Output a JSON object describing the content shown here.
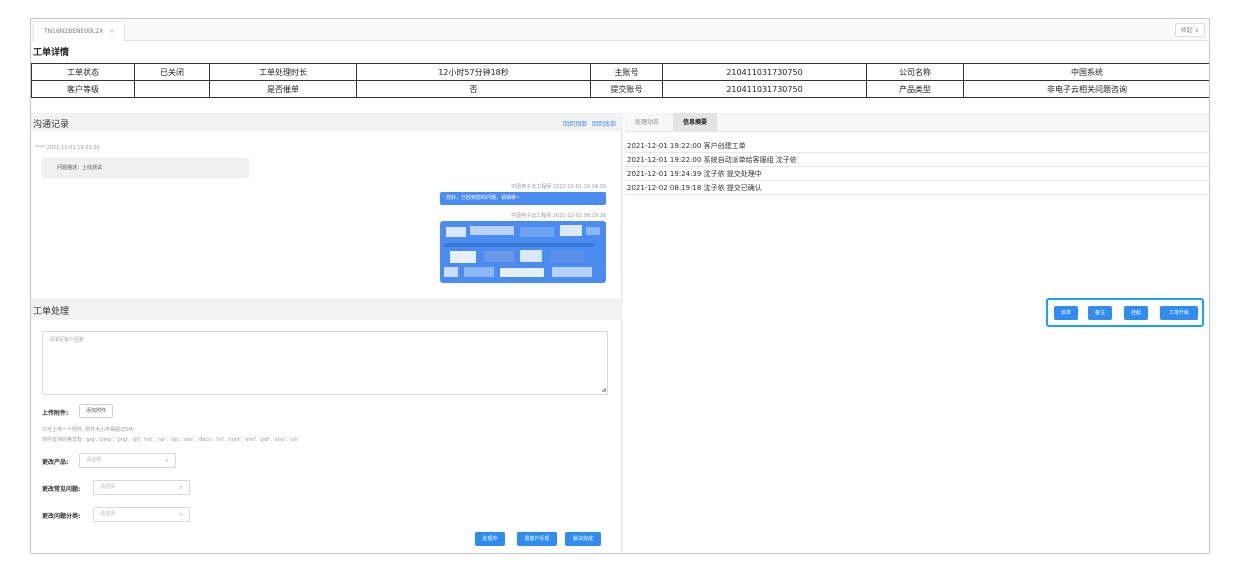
{
  "tab": {
    "title": "TN16N2BENE00L2X",
    "close": "×"
  },
  "header": {
    "collapse": "收起 ∨"
  },
  "ticket_detail": {
    "title": "工单详情"
  },
  "info_table": {
    "row1": [
      "工单状态",
      "已关闭",
      "工单处理时长",
      "12小时57分钟18秒",
      "主账号",
      "210411031730750",
      "公司名称",
      "中国系统"
    ],
    "row2": [
      "客户等级",
      "",
      "是否催单",
      "否",
      "提交账号",
      "210411031730750",
      "产品类型",
      "非电子云相关问题咨询"
    ]
  },
  "chat": {
    "title": "沟通记录",
    "link_top": "回到顶部",
    "link_bottom": "回到底部",
    "customer_meta": "****  2021-12-01 19:22:00",
    "customer_msg": "问题描述：上线测试",
    "agent_meta1": "中国电子云工程师  2021-12-01 19:24:39",
    "agent_msg1": "您好，已收到您的问题，请稍等~",
    "agent_meta2": "中国电子云工程师  2021-12-02 08:19:18"
  },
  "right_panel": {
    "tabs": [
      "处理动态",
      "信息摘要"
    ],
    "log": [
      "2021-12-01 19:22:00 客户创建工单",
      "2021-12-01 19:22:00 系统自动派单给客服组 沈子依",
      "2021-12-01 19:24:39 沈子依 提交处理中",
      "2021-12-02 08:19:18 沈子依 提交已确认"
    ],
    "actions": [
      "派单",
      "备注",
      "挂起",
      "工单升级"
    ]
  },
  "processing": {
    "title": "工单处理",
    "reply_placeholder": "请填写客户回复",
    "upload_label": "上传附件:",
    "upload_button": "添加附件",
    "hint1": "只可上传一个附件, 附件大小不得超过5M;",
    "hint2": "附件支持的格式有: 'jpg', 'bmp', 'png', 'gif', 'txt', 'rar', 'zip', 'doc', 'docx', 'ini', 'conf', 'eml', 'pdf', 'xlsx', 'xls'",
    "change_product_label": "更改产品:",
    "change_faq_label": "更改常见问题:",
    "change_category_label": "更改问题分类:",
    "select_placeholder": "请选择",
    "buttons": [
      "处理中",
      "需客户反馈",
      "解决完成"
    ]
  },
  "colors": {
    "primary": "#2f8cf0",
    "highlight_border": "#1ea0ff"
  }
}
